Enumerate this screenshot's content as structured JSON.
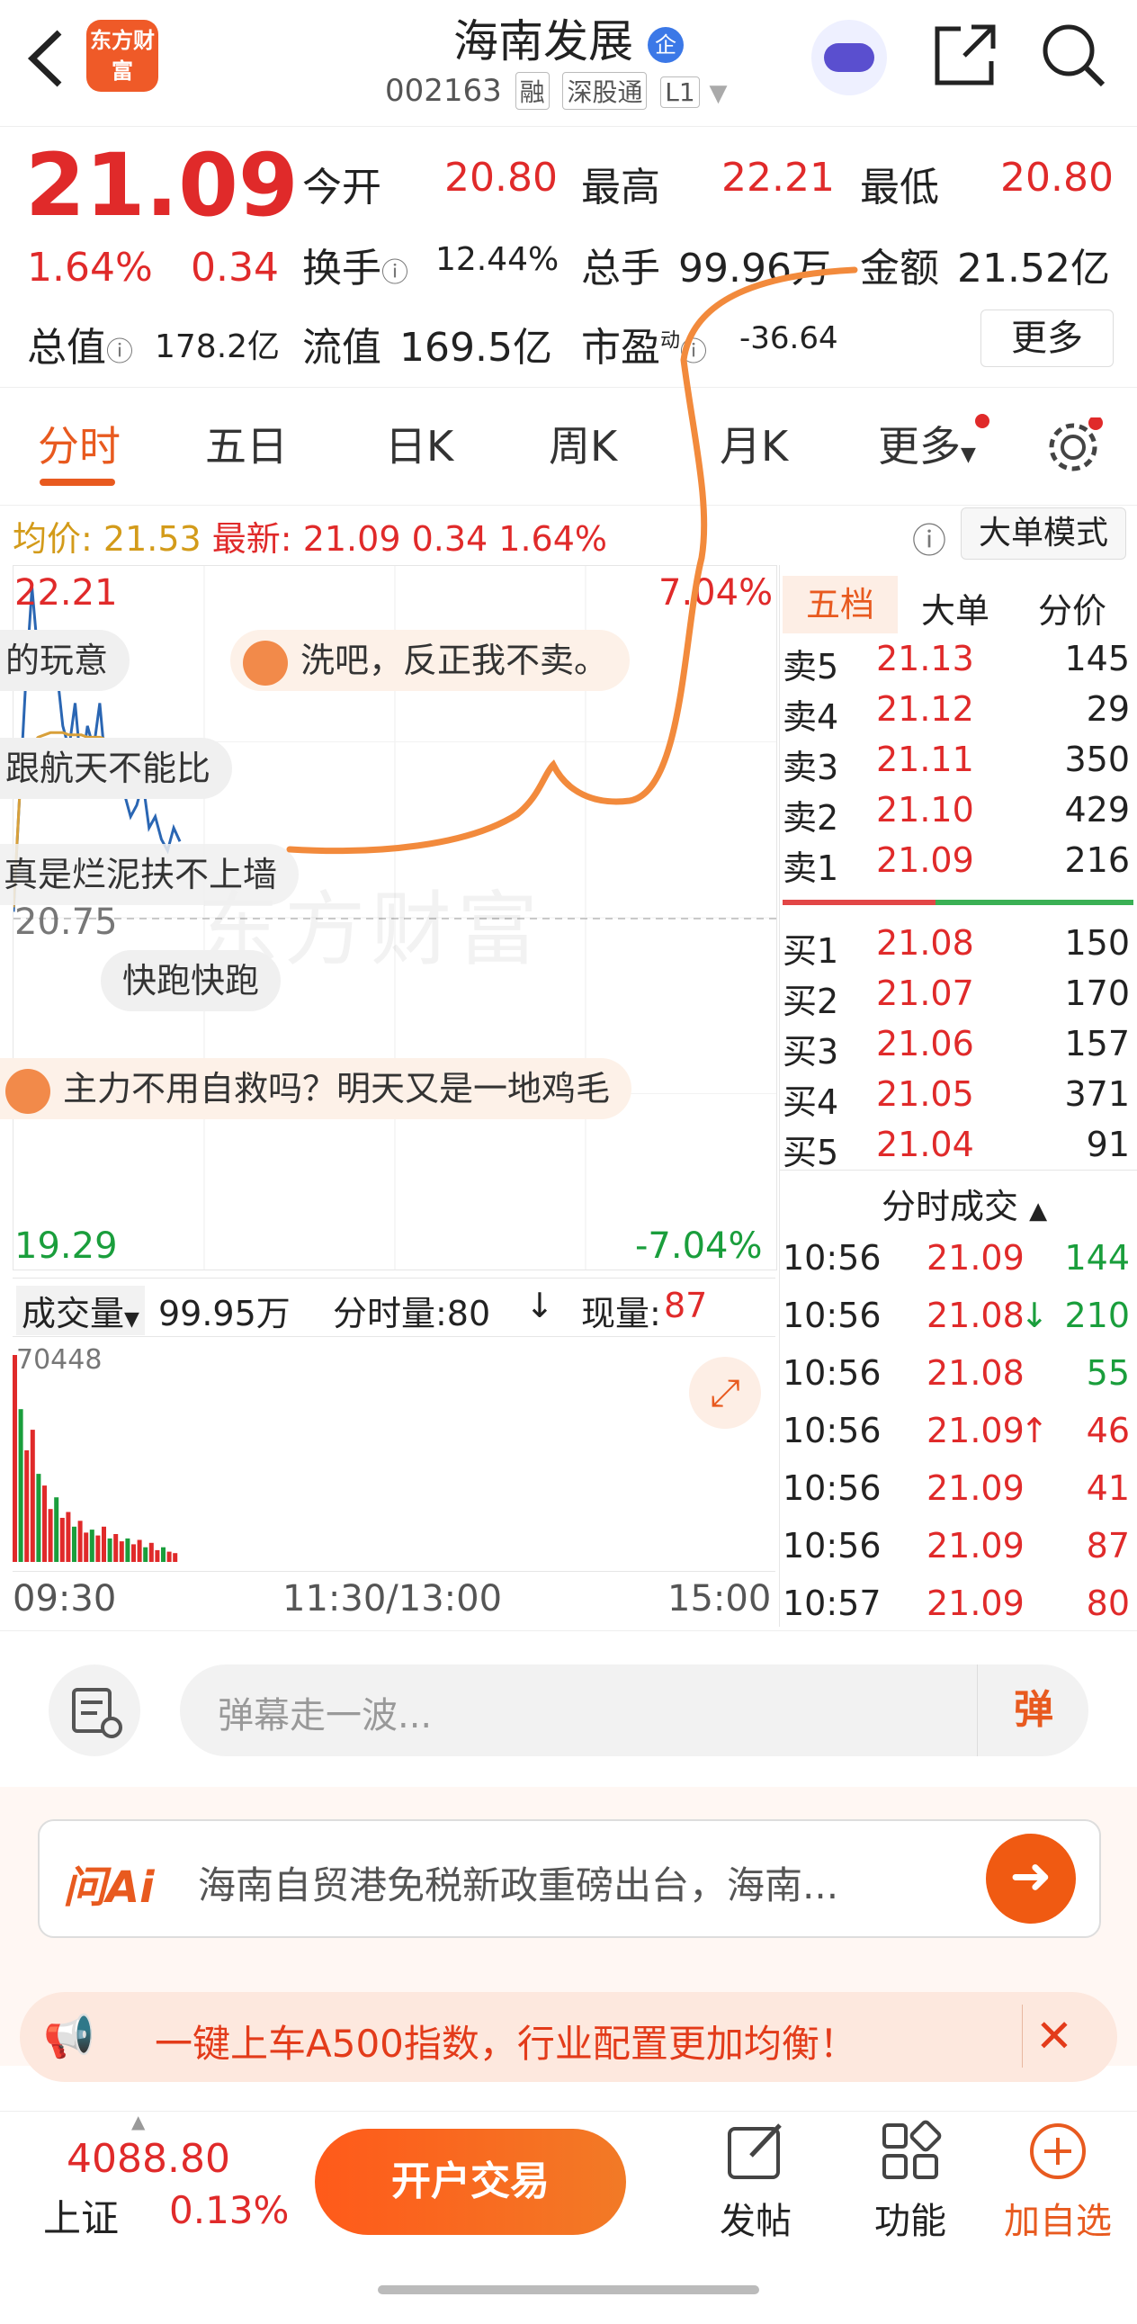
{
  "header": {
    "logo_text": "东方财富",
    "stock_name": "海南发展",
    "badge": "企",
    "code": "002163",
    "tags": [
      "融",
      "深股通",
      "L1"
    ]
  },
  "quote": {
    "price": "21.09",
    "pct": "1.64%",
    "chg": "0.34",
    "open_label": "今开",
    "open": "20.80",
    "high_label": "最高",
    "high": "22.21",
    "low_label": "最低",
    "low": "20.80",
    "turnover_label": "换手",
    "turnover": "12.44%",
    "volume_label": "总手",
    "volume": "99.96万",
    "amount_label": "金额",
    "amount": "21.52亿",
    "mcap_label": "总值",
    "mcap": "178.2亿",
    "float_label": "流值",
    "float": "169.5亿",
    "pe_label": "市盈",
    "pe_sup": "动",
    "pe": "-36.64",
    "more_btn": "更多"
  },
  "tabs": [
    "分时",
    "五日",
    "日K",
    "周K",
    "月K",
    "更多"
  ],
  "info_bar": {
    "avg_label": "均价:",
    "avg": "21.53",
    "latest_label": "最新:",
    "latest": "21.09",
    "chg": "0.34",
    "pct": "1.64%",
    "bigmode": "大单模式"
  },
  "chart": {
    "high_label": "22.21",
    "high_pct": "7.04%",
    "ref_label": "20.75",
    "low_label": "19.29",
    "low_pct": "-7.04%",
    "watermark": "东方财富",
    "vol_label": "成交量",
    "vol": "99.95万",
    "interval_label": "分时量:80",
    "now_label": "现量:",
    "now": "87",
    "vol_max": "70448",
    "time_start": "09:30",
    "time_mid": "11:30/13:00",
    "time_end": "15:00"
  },
  "chart_data": {
    "type": "line",
    "series": [
      {
        "values": [
          20.78,
          21.3,
          21.8,
          22.21,
          21.9,
          22.0,
          21.8,
          21.85,
          21.6,
          21.5,
          21.7,
          21.4,
          21.6,
          21.5,
          21.7,
          21.4,
          21.3,
          21.45,
          21.3,
          21.2,
          21.25,
          21.35,
          21.15,
          21.2,
          21.1,
          21.05,
          21.15,
          21.09
        ]
      },
      {
        "values": [
          20.8,
          21.3,
          21.45,
          21.52,
          21.55,
          21.56,
          21.57,
          21.57,
          21.57,
          21.56,
          21.56,
          21.56,
          21.55,
          21.55,
          21.55,
          21.54,
          21.54,
          21.54,
          21.54,
          21.53,
          21.53,
          21.53,
          21.53,
          21.53,
          21.53,
          21.53,
          21.53,
          21.53
        ]
      }
    ],
    "ylim": [
      19.29,
      22.21
    ],
    "ref": 20.75,
    "volume": [
      70448,
      52000,
      38000,
      45000,
      30000,
      26000,
      18000,
      22000,
      15000,
      17000,
      12000,
      14000,
      10000,
      11000,
      9000,
      12000,
      8000,
      9500,
      7000,
      8000,
      6000,
      7500,
      5000,
      6500,
      4000,
      5000,
      3500,
      3000
    ]
  },
  "danmu": [
    "的玩意",
    "洗吧，反正我不卖。",
    "跟航天不能比",
    "真是烂泥扶不上墙",
    "快跑快跑",
    "主力不用自救吗？明天又是一地鸡毛"
  ],
  "orderbook": {
    "tabs": [
      "五档",
      "大单",
      "分价"
    ],
    "asks": [
      {
        "label": "卖5",
        "price": "21.13",
        "vol": "145"
      },
      {
        "label": "卖4",
        "price": "21.12",
        "vol": "29"
      },
      {
        "label": "卖3",
        "price": "21.11",
        "vol": "350"
      },
      {
        "label": "卖2",
        "price": "21.10",
        "vol": "429"
      },
      {
        "label": "卖1",
        "price": "21.09",
        "vol": "216"
      }
    ],
    "bids": [
      {
        "label": "买1",
        "price": "21.08",
        "vol": "150"
      },
      {
        "label": "买2",
        "price": "21.07",
        "vol": "170"
      },
      {
        "label": "买3",
        "price": "21.06",
        "vol": "157"
      },
      {
        "label": "买4",
        "price": "21.05",
        "vol": "371"
      },
      {
        "label": "买5",
        "price": "21.04",
        "vol": "91"
      }
    ],
    "ticks_title": "分时成交",
    "ticks": [
      {
        "time": "10:56",
        "price": "21.09",
        "vol": "144",
        "arrow": ""
      },
      {
        "time": "10:56",
        "price": "21.08",
        "vol": "210",
        "arrow": "↓"
      },
      {
        "time": "10:56",
        "price": "21.08",
        "vol": "55",
        "arrow": ""
      },
      {
        "time": "10:56",
        "price": "21.09",
        "vol": "46",
        "arrow": "↑"
      },
      {
        "time": "10:56",
        "price": "21.09",
        "vol": "41",
        "arrow": ""
      },
      {
        "time": "10:56",
        "price": "21.09",
        "vol": "87",
        "arrow": ""
      },
      {
        "time": "10:57",
        "price": "21.09",
        "vol": "80",
        "arrow": ""
      }
    ]
  },
  "comment": {
    "placeholder": "弹幕走一波...",
    "danmu_btn": "弹"
  },
  "ai": {
    "logo": "问Ai",
    "text": "海南自贸港免税新政重磅出台，海南..."
  },
  "promo": {
    "text": "一键上车A500指数，行业配置更加均衡！"
  },
  "footer": {
    "index_value": "4088.80",
    "index_name": "上证",
    "index_pct": "0.13%",
    "trade_btn": "开户交易",
    "post": "发帖",
    "func": "功能",
    "watch": "加自选"
  }
}
